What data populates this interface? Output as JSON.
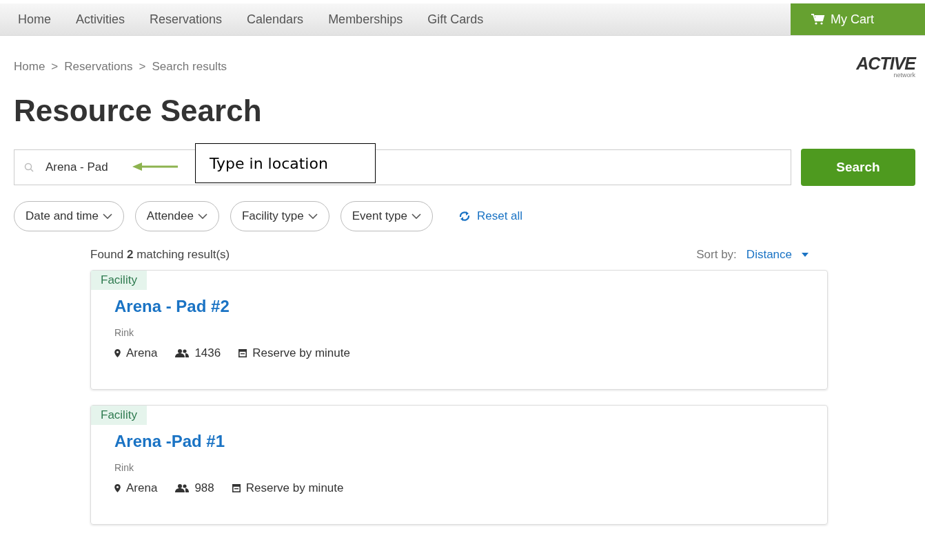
{
  "nav": {
    "items": [
      {
        "label": "Home"
      },
      {
        "label": "Activities"
      },
      {
        "label": "Reservations"
      },
      {
        "label": "Calendars"
      },
      {
        "label": "Memberships"
      },
      {
        "label": "Gift Cards"
      }
    ],
    "cart": "My Cart"
  },
  "breadcrumb": [
    "Home",
    "Reservations",
    "Search results"
  ],
  "breadcrumb_separator": ">",
  "logo": {
    "word": "ACTIVE",
    "sub": "network"
  },
  "title": "Resource Search",
  "search": {
    "value": "Arena - Pad",
    "button": "Search"
  },
  "callout": "Type in location",
  "filters": [
    {
      "label": "Date and time"
    },
    {
      "label": "Attendee"
    },
    {
      "label": "Facility type"
    },
    {
      "label": "Event type"
    }
  ],
  "reset": "Reset all",
  "found": "Found **2** matching result(s)",
  "sort": {
    "label": "Sort by:",
    "value": "Distance"
  },
  "results": [
    {
      "tag": "Facility",
      "name": "Arena - Pad #2",
      "type": "Rink",
      "location": "Arena",
      "capacity": "1436",
      "reserve": "Reserve by minute"
    },
    {
      "tag": "Facility",
      "name": "Arena -Pad #1",
      "type": "Rink",
      "location": "Arena",
      "capacity": "988",
      "reserve": "Reserve by minute"
    }
  ]
}
